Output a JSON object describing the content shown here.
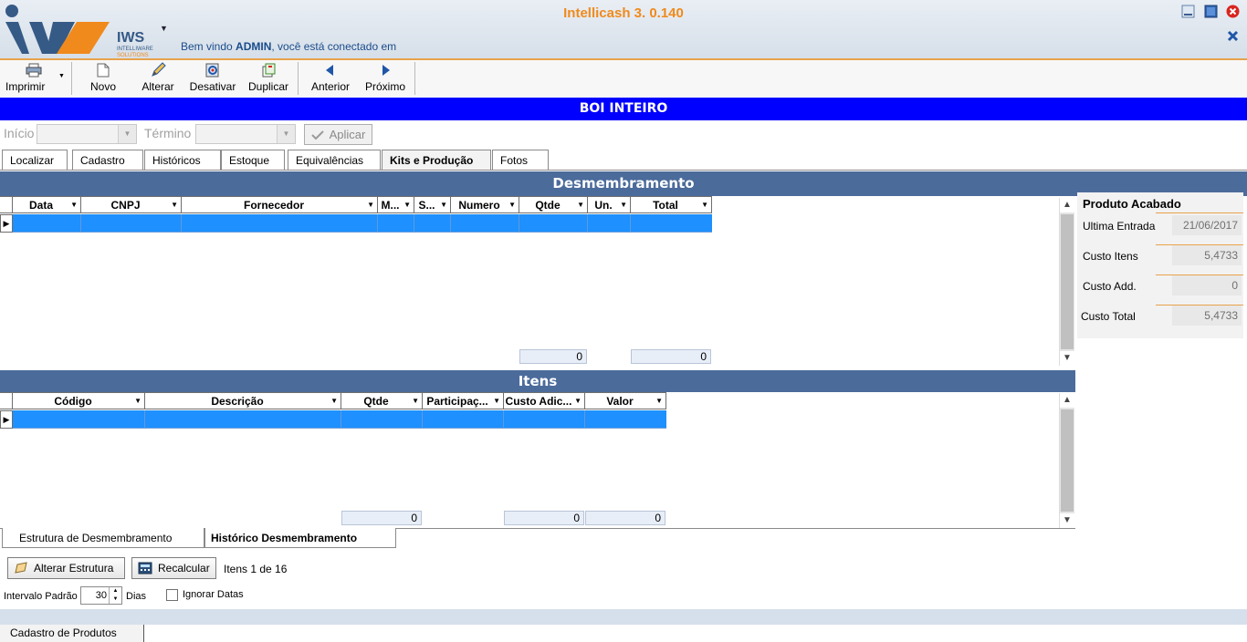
{
  "header": {
    "logo_text": "IWS",
    "logo_sub": "INTELLIWARE SOLUTIONS",
    "app_title": "Intellicash 3. 0.140",
    "welcome_prefix": "Bem vindo",
    "welcome_user": "ADMIN",
    "welcome_suffix": ", você está conectado em"
  },
  "toolbar": {
    "print": "Imprimir",
    "new": "Novo",
    "edit": "Alterar",
    "deactivate": "Desativar",
    "duplicate": "Duplicar",
    "previous": "Anterior",
    "next": "Próximo"
  },
  "record_title": "BOI INTEIRO",
  "filter": {
    "start_label": "Início",
    "end_label": "Término",
    "apply_label": "Aplicar"
  },
  "tabs": [
    "Localizar",
    "Cadastro",
    "Históricos",
    "Estoque",
    "Equivalências",
    "Kits e Produção",
    "Fotos"
  ],
  "active_tab": "Kits e Produção",
  "desmembramento": {
    "title": "Desmembramento",
    "columns": [
      "Data",
      "CNPJ",
      "Fornecedor",
      "M...",
      "S...",
      "Numero",
      "Qtde",
      "Un.",
      "Total"
    ],
    "sum_qtde": "0",
    "sum_total": "0"
  },
  "itens": {
    "title": "Itens",
    "columns": [
      "Código",
      "Descrição",
      "Qtde",
      "Participaç...",
      "Custo Adic...",
      "Valor"
    ],
    "sum_qtde": "0",
    "sum_custo": "0",
    "sum_valor": "0"
  },
  "produto_acabado": {
    "title": "Produto Acabado",
    "ultima_entrada_label": "Ultima Entrada",
    "ultima_entrada": "21/06/2017",
    "custo_itens_label": "Custo Itens",
    "custo_itens": "5,4733",
    "custo_add_label": "Custo Add.",
    "custo_add": "0",
    "custo_total_label": "Custo Total",
    "custo_total": "5,4733"
  },
  "bottom_tabs": [
    "Estrutura de Desmembramento",
    "Histórico Desmembramento"
  ],
  "actions": {
    "alterar_estrutura": "Alterar Estrutura",
    "recalcular": "Recalcular",
    "itens_count": "Itens 1 de 16",
    "intervalo_label": "Intervalo Padrão",
    "intervalo_value": "30",
    "dias_label": "Dias",
    "ignorar_label": "Ignorar Datas"
  },
  "footer_tab": "Cadastro de Produtos",
  "colors": {
    "title_bar": "#0000ff",
    "section_bar": "#4b6b9b",
    "selected_row": "#1e90ff",
    "app_title": "#f08a1c"
  }
}
